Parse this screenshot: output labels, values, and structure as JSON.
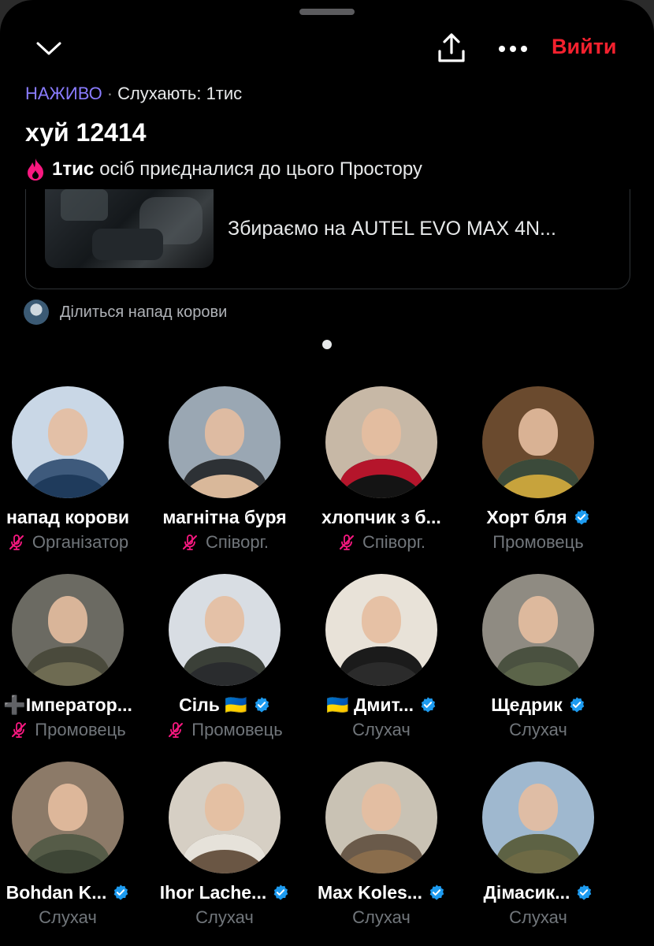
{
  "header": {
    "leave_label": "Вийти",
    "live_label": "НАЖИВО",
    "separator": "·",
    "listeners_label": "Слухають: 1тис"
  },
  "space": {
    "title": "хуй 12414",
    "joined_count": "1тис",
    "joined_text": "осіб приєдналися до цього Простору",
    "shared_card_text": "Збираємо на AUTEL EVO MAX 4N...",
    "shared_by": "Ділиться напад корови"
  },
  "colors": {
    "accent_live": "#8a7cff",
    "leave_red": "#f4212e",
    "verified_blue": "#1d9bf0",
    "mic_off_pink": "#f91880",
    "muted_text": "#71767b"
  },
  "participants": [
    {
      "name": "напад корови",
      "role": "Організатор",
      "verified": false,
      "muted": true
    },
    {
      "name": "магнітна буря",
      "role": "Співорг.",
      "verified": false,
      "muted": true
    },
    {
      "name": "хлопчик з б...",
      "role": "Співорг.",
      "verified": false,
      "muted": true
    },
    {
      "name": "Хорт бля",
      "role": "Промовець",
      "verified": true,
      "muted": false
    },
    {
      "name": "➕Імператор...",
      "role": "Промовець",
      "verified": false,
      "muted": true
    },
    {
      "name": "Сіль 🇺🇦",
      "role": "Промовець",
      "verified": true,
      "muted": true
    },
    {
      "name": "🇺🇦 Дмит...",
      "role": "Слухач",
      "verified": true,
      "muted": false
    },
    {
      "name": "Щедрик",
      "role": "Слухач",
      "verified": true,
      "muted": false
    },
    {
      "name": "Bohdan K...",
      "role": "Слухач",
      "verified": true,
      "muted": false
    },
    {
      "name": "Ihor Lache...",
      "role": "Слухач",
      "verified": true,
      "muted": false
    },
    {
      "name": "Max Koles...",
      "role": "Слухач",
      "verified": true,
      "muted": false
    },
    {
      "name": "Дімасик...",
      "role": "Слухач",
      "verified": true,
      "muted": false
    }
  ]
}
